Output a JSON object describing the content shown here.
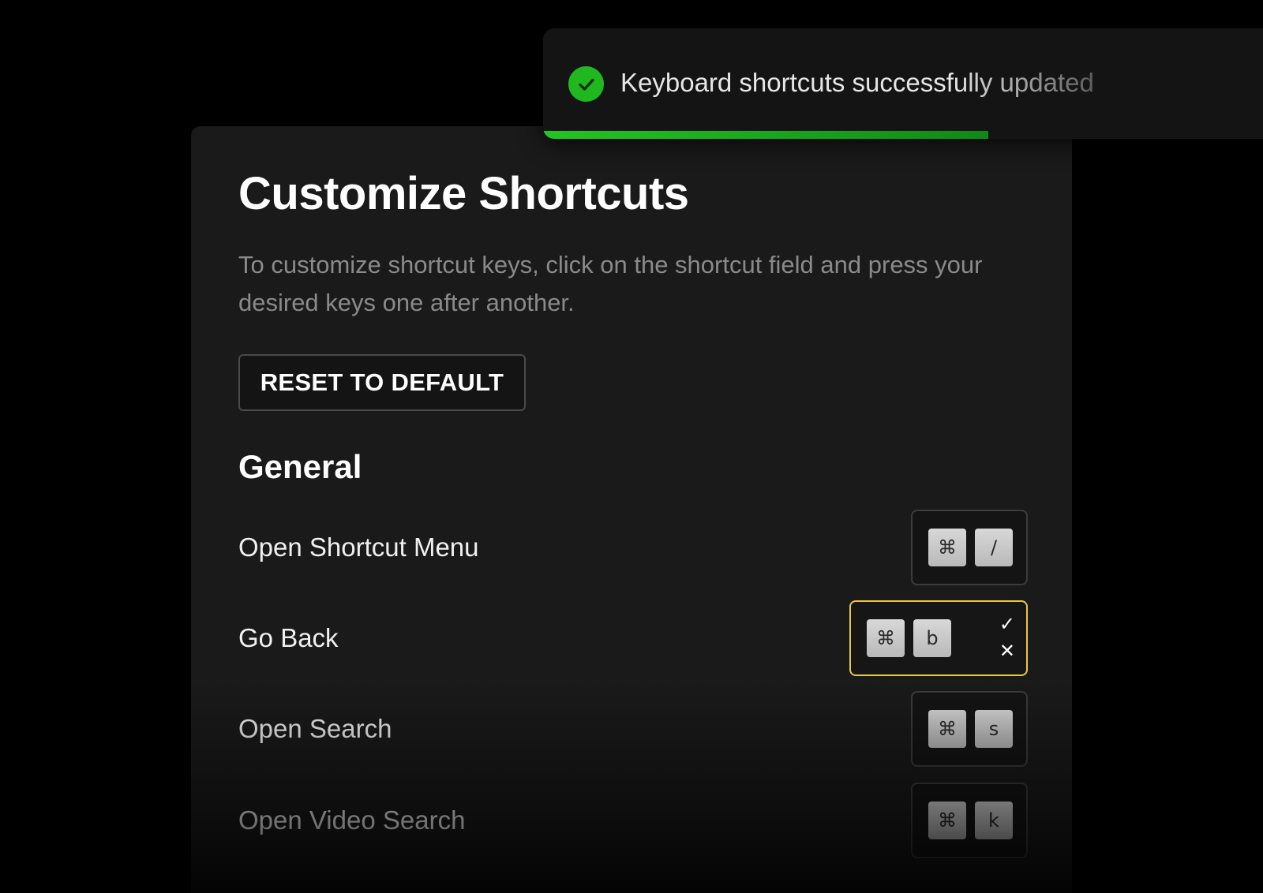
{
  "toast": {
    "message": "Keyboard shortcuts successfully updated",
    "icon": "check-circle-icon",
    "progress": 0.6,
    "color": "#1fb81f"
  },
  "panel": {
    "title": "Customize Shortcuts",
    "description": "To customize shortcut keys, click on the shortcut field and press your desired keys one after another.",
    "reset_label": "RESET TO DEFAULT",
    "section_title": "General",
    "shortcuts": [
      {
        "label": "Open Shortcut Menu",
        "keys": [
          "⌘",
          "/"
        ]
      },
      {
        "label": "Go Back",
        "keys": [
          "⌘",
          "b"
        ],
        "editing": true,
        "confirm": "✓",
        "cancel": "✕"
      },
      {
        "label": "Open Search",
        "keys": [
          "⌘",
          "s"
        ]
      },
      {
        "label": "Open Video Search",
        "keys": [
          "⌘",
          "k"
        ]
      }
    ]
  },
  "colors": {
    "editing_border": "#e8c64a",
    "background": "#000000",
    "panel": "#1a1a1a"
  }
}
